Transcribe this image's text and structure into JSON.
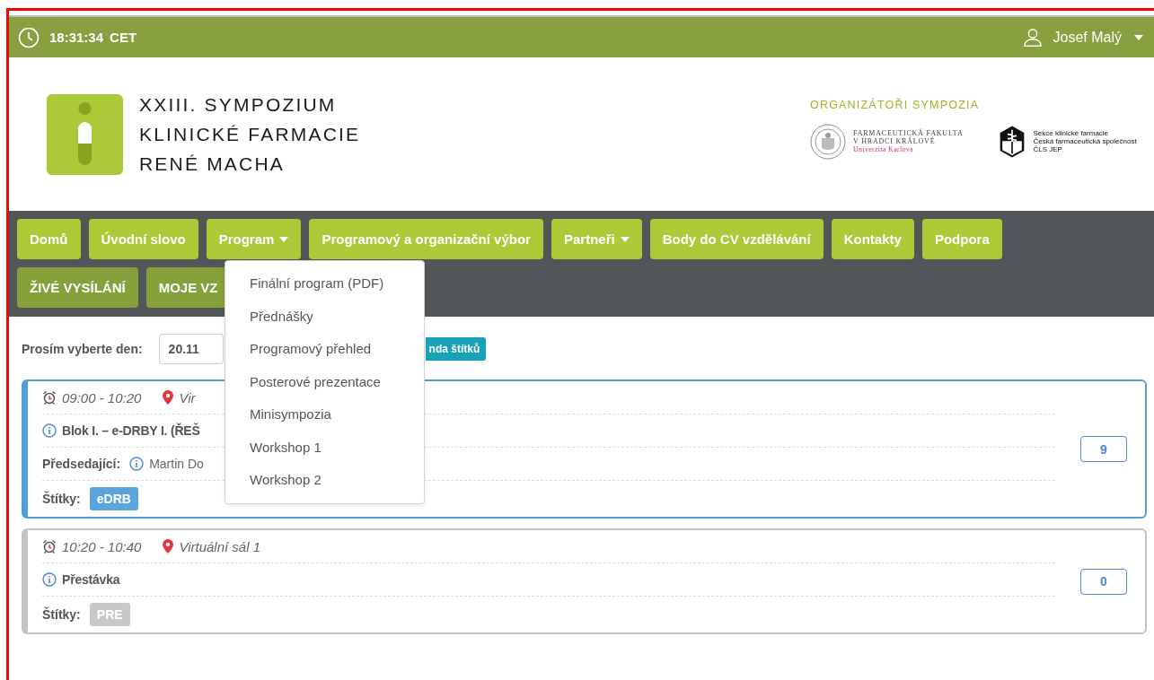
{
  "top_bar": {
    "time": "18:31:34",
    "timezone": "CET",
    "user": "Josef Malý"
  },
  "header": {
    "title_lines": [
      "XXIII. SYMPOZIUM",
      "KLINICKÉ FARMACIE",
      "RENÉ MACHA"
    ],
    "organizers_label": "ORGANIZÁTOŘI SYMPOZIA",
    "organizers": [
      {
        "kind": "faculty",
        "lines": [
          "FARMACEUTICKÁ FAKULTA",
          "V HRADCI KRÁLOVÉ",
          "Univerzita Karlova"
        ]
      },
      {
        "kind": "section",
        "lines": [
          "Sekce klinické farmacie",
          "Česká farmaceutická společnost",
          "ČLS JEP"
        ]
      }
    ]
  },
  "nav": {
    "rows": [
      [
        {
          "label": "Domů",
          "has_menu": false
        },
        {
          "label": "Úvodní slovo",
          "has_menu": false
        },
        {
          "label": "Program",
          "has_menu": true,
          "menu": [
            "Finální program (PDF)",
            "Přednášky",
            "Programový přehled",
            "Posterové prezentace",
            "Minisympozia",
            "Workshop 1",
            "Workshop 2"
          ]
        },
        {
          "label": "Programový a organizační výbor",
          "has_menu": false
        },
        {
          "label": "Partneři",
          "has_menu": true
        },
        {
          "label": "Body do CV vzdělávání",
          "has_menu": false
        },
        {
          "label": "Kontakty",
          "has_menu": false
        },
        {
          "label": "Podpora",
          "has_menu": false
        }
      ],
      [
        {
          "label": "ŽIVÉ VYSÍLÁNÍ",
          "has_menu": false
        },
        {
          "label": "MOJE VZ",
          "has_menu": false
        }
      ]
    ]
  },
  "day_picker": {
    "label": "Prosím vyberte den:",
    "value": "20.11",
    "legend_button": "nda štítků"
  },
  "sessions": [
    {
      "active": true,
      "time": "09:00 - 10:20",
      "location": "Vir",
      "title": "Blok I. – e-DRBY I. (ŘEŠ",
      "chair_label": "Předsedající:",
      "chair": "Martin Do",
      "tags_label": "Štítky:",
      "tags": [
        {
          "label": "eDRB",
          "color": "#5aa5dc"
        }
      ],
      "count": "9"
    },
    {
      "active": false,
      "time": "10:20 - 10:40",
      "location": "Virtuální sál 1",
      "title": "Přestávka",
      "tags_label": "Štítky:",
      "tags": [
        {
          "label": "PRE",
          "color": "#c8c8c8"
        }
      ],
      "count": "0"
    }
  ]
}
